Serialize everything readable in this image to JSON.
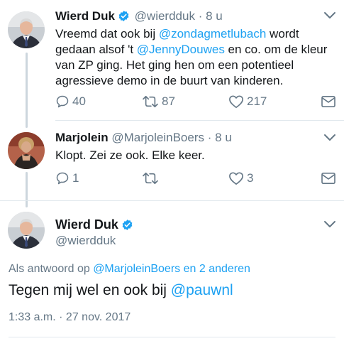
{
  "colors": {
    "link": "#1da1f2",
    "muted": "#657786",
    "text": "#14171a",
    "verified": "#1da1f2",
    "line": "#ccd6dd"
  },
  "tweets": [
    {
      "name": "Wierd Duk",
      "verified": true,
      "handle": "@wierdduk",
      "separator": "·",
      "time": "8 u",
      "text": {
        "l1_a": "Vreemd dat ook bij ",
        "l1_mention": "@zondagmetlubach",
        "l1_b": " wordt",
        "l2_a": "gedaan alsof 't ",
        "l2_mention": "@JennyDouwes",
        "l2_b": " en co. om de kleur",
        "l3": "van ZP ging. Het ging hen om een potentieel",
        "l4": "agressieve demo in de buurt van kinderen."
      },
      "actions": {
        "reply_count": "40",
        "retweet_count": "87",
        "like_count": "217"
      }
    },
    {
      "name": "Marjolein",
      "handle": "@MarjoleinBoers",
      "separator": "·",
      "time": "8 u",
      "text": "Klopt. Zei ze ook. Elke keer.",
      "actions": {
        "reply_count": "1",
        "retweet_count": "",
        "like_count": "3"
      }
    }
  ],
  "main_tweet": {
    "name": "Wierd Duk",
    "verified": true,
    "handle": "@wierdduk",
    "reply_prefix": "Als antwoord op ",
    "reply_targets": "@MarjoleinBoers en 2 anderen",
    "text_a": "Tegen mij wel en ook bij ",
    "text_mention": "@pauwnl",
    "timestamp": "1:33 a.m. · 27 nov. 2017"
  },
  "icons": {
    "reply": "reply-icon",
    "retweet": "retweet-icon",
    "like": "heart-icon",
    "dm": "envelope-icon",
    "menu": "chevron-down-icon",
    "verified": "verified-badge-icon"
  }
}
